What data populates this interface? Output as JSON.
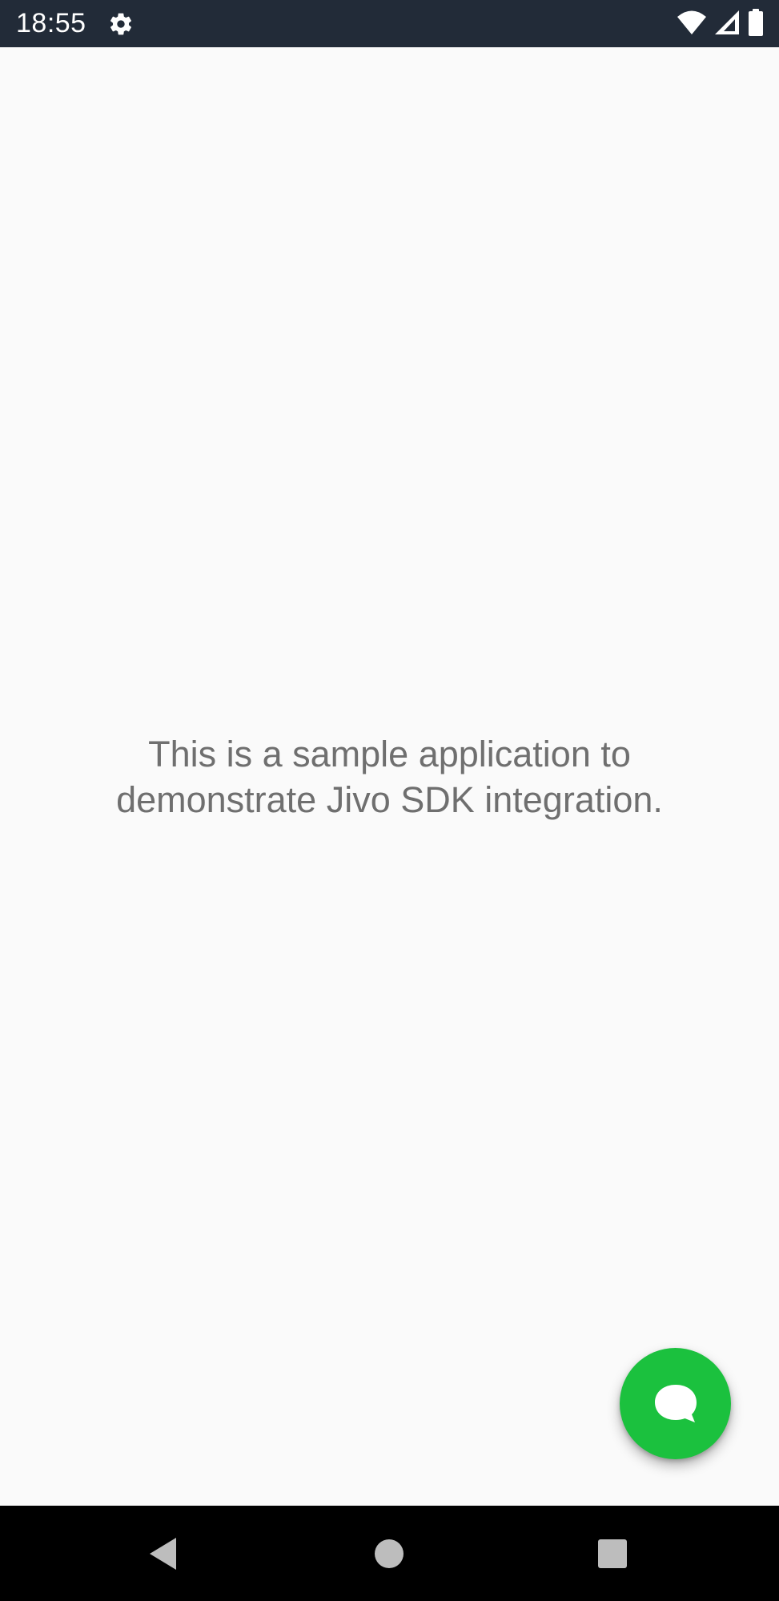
{
  "status_bar": {
    "time": "18:55",
    "icons": [
      "gear-icon",
      "wifi-icon",
      "cell-signal-icon",
      "battery-icon"
    ],
    "background": "#222b38"
  },
  "main": {
    "description": "This is a sample application to demonstrate Jivo SDK integration."
  },
  "chat_fab": {
    "icon": "chat-bubble-icon",
    "color": "#1bc13e"
  },
  "navigation_bar": {
    "buttons": [
      "back-icon",
      "home-icon",
      "recents-icon"
    ]
  }
}
